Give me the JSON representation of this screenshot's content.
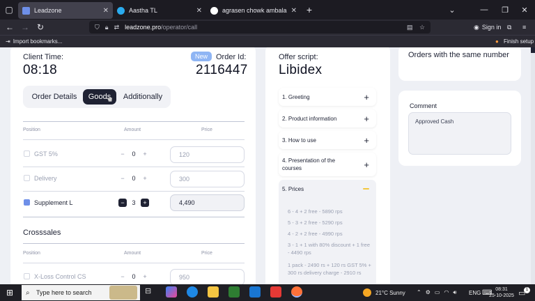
{
  "browser": {
    "tabs": [
      {
        "title": "Leadzone",
        "active": true,
        "favicon_color": "#6e8fe8"
      },
      {
        "title": "Aastha TL",
        "active": false,
        "favicon_color": "#2aabee"
      },
      {
        "title": "agrasen chowk ambala city - Go",
        "active": false,
        "favicon_color": "#ffffff"
      }
    ],
    "url_host": "leadzone.pro",
    "url_path": "/operator/call",
    "sign_in": "Sign in",
    "bookmarks": {
      "import": "Import bookmarks...",
      "finish": "Finish setup"
    }
  },
  "order": {
    "client_time_label": "Client Time:",
    "client_time": "08:18",
    "badge": "New",
    "order_id_label": "Order Id:",
    "order_id": "2116447",
    "tabs": [
      "Order Details",
      "Goods",
      "Additionally"
    ],
    "active_tab": "Goods",
    "columns": {
      "position": "Position",
      "amount": "Amount",
      "price": "Price"
    },
    "goods": [
      {
        "name": "GST 5%",
        "qty": "0",
        "price": "120",
        "selected": false
      },
      {
        "name": "Delivery",
        "qty": "0",
        "price": "300",
        "selected": false
      },
      {
        "name": "Supplement L",
        "qty": "3",
        "price": "4,490",
        "selected": true
      }
    ],
    "crosssales_title": "Crosssales",
    "crosssales": [
      {
        "name": "X-Loss Control CS",
        "qty": "0",
        "price": "950",
        "selected": false
      }
    ]
  },
  "script": {
    "label": "Offer script:",
    "product": "Libidex",
    "items": [
      "1. Greeting",
      "2. Product information",
      "3. How to use",
      "4. Presentation of the courses",
      "5. Prices"
    ],
    "open_item": "5. Prices",
    "prices": [
      "6 - 4 + 2 free - 5890 rps",
      "5 - 3 + 2 free - 5290 rps",
      "4 - 2 + 2 free - 4990 rps",
      "3 - 1 + 1 with 80% discount + 1 free - 4490 rps",
      "1 pack - 2490 rs + 120 rs GST 5% + 300 rs delivery charge - 2910 rs"
    ]
  },
  "right": {
    "same_number": "Orders with the same number",
    "comment_label": "Comment",
    "comment": "Approved Cash"
  },
  "taskbar": {
    "search": "Type here to search",
    "weather": "21°C  Sunny",
    "lang": "ENG",
    "time": "08:31",
    "date": "25-10-2025",
    "notif_count": "1"
  },
  "colors": {
    "accent": "#6e8fe8",
    "dark": "#1f2233",
    "minus": "#f2c73c"
  }
}
